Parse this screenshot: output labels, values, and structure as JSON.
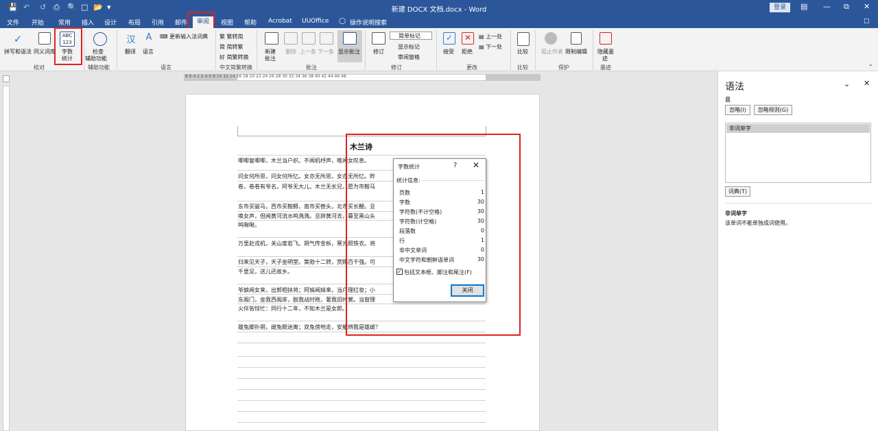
{
  "title_bar": {
    "doc_title": "新建 DOCX 文档.docx  -  Word",
    "login": "登录"
  },
  "menu_tabs": [
    "文件",
    "开始",
    "常用",
    "插入",
    "设计",
    "布局",
    "引用",
    "邮件",
    "视图",
    "帮助",
    "Acrobat",
    "UUOffice",
    "操作说明搜索"
  ],
  "active_tab": "审阅",
  "ribbon": {
    "proofing": {
      "spelling": "拼写和语法",
      "thesaurus": "同义词库",
      "wordcount_line1": "字数",
      "wordcount_line2": "统计",
      "abc": "ABC",
      "num": "123",
      "group": "校对"
    },
    "accessibility": {
      "check": "检查",
      "check2": "辅助功能",
      "group": "辅助功能"
    },
    "language": {
      "translate": "翻译",
      "language": "语言",
      "ime": "更新输入法词典",
      "group": "语言"
    },
    "chinese": {
      "to_trad": "繁转简",
      "to_simp": "简转繁",
      "convert": "简繁转换",
      "group": "中文简繁转换"
    },
    "comments": {
      "new1": "新建",
      "new2": "批注",
      "delete": "删除",
      "prev": "上一条",
      "next": "下一条",
      "show": "显示批注",
      "group": "批注"
    },
    "tracking": {
      "track": "修订",
      "markup": "简单标记",
      "show_markup": "显示标记",
      "pane": "审阅窗格",
      "group": "修订"
    },
    "changes": {
      "accept": "接受",
      "reject": "拒绝",
      "prev": "上一处",
      "next": "下一处",
      "group": "更改"
    },
    "compare": {
      "compare": "比较",
      "group": "比较"
    },
    "protect": {
      "block": "阻止作者",
      "restrict": "限制编辑",
      "group": "保护"
    },
    "ink": {
      "hide1": "隐藏墨",
      "hide2": "迹",
      "group": "墨迹"
    }
  },
  "ruler_numbers": "8   6   4   2       2   4   6   8  10  12  14  16  18  20  22  24  26  28  30  32  34  36  38  40  42  44  46  48",
  "document": {
    "title": "木兰诗",
    "lines": [
      "唧唧复唧唧，木兰当户织。不闻机杼声，唯闻女叹息。",
      "问女何所思，问女何所忆。女亦无所思，女亦无所忆。昨",
      "卷，卷卷有爷名。阿爷无大儿，木兰无长兄，愿为市鞍马",
      "东市买骏马，西市买鞍鞯，南市买辔头，北市买长鞭。旦",
      "唤女声，但闻黄河流水鸣溅溅。旦辞黄河去，暮至黑山头",
      "鸣啾啾。",
      "万里赴戎机，关山度若飞。朔气传金柝，寒光照铁衣。将",
      "归来见天子，天子坐明堂。策勋十二转，赏赐百千强。可",
      "千里足，送儿还故乡。",
      "爷娘闻女来，出郭相扶将；阿姊闻妹来，当户理红妆；小",
      "东阁门，坐我西阁床，脱我战时袍，著我旧时裳。当窗理",
      "火伴皆惊忙：同行十二年，不知木兰是女郎。",
      "雄兔脚扑朔，雌兔眼迷离；双兔傍地走，安能辨我是雄雌？"
    ]
  },
  "dialog": {
    "title": "字数统计",
    "help": "?",
    "close_x": "✕",
    "section": "统计信息:",
    "rows": [
      {
        "label": "页数",
        "value": "1"
      },
      {
        "label": "字数",
        "value": "30"
      },
      {
        "label": "字符数(不计空格)",
        "value": "30"
      },
      {
        "label": "字符数(计空格)",
        "value": "30"
      },
      {
        "label": "段落数",
        "value": "0"
      },
      {
        "label": "行",
        "value": "1"
      },
      {
        "label": "非中文单词",
        "value": "0"
      },
      {
        "label": "中文字符和朝鲜语单词",
        "value": "30"
      }
    ],
    "checkbox_label": "包括文本框、脚注和尾注(F)",
    "close_button": "关闭"
  },
  "pane": {
    "title": "语法",
    "subtitle": "旦",
    "ignore": "忽略(I)",
    "ignore_rule": "忽略规则(G)",
    "suggestion": "非词单字",
    "dictionary": "词典(T)",
    "explain_title": "非词单字",
    "explain_text": "该单词不能单独成词使用。"
  }
}
